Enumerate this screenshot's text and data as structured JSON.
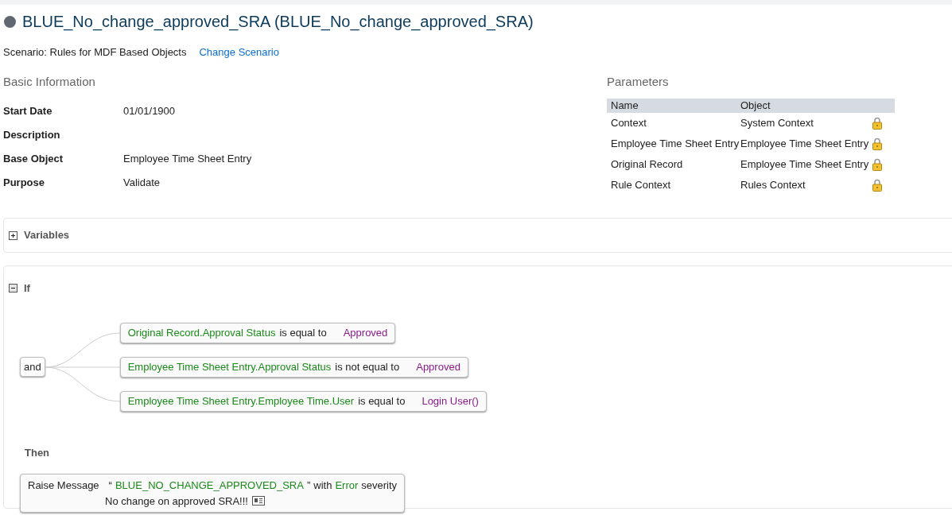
{
  "header": {
    "title": "BLUE_No_change_approved_SRA (BLUE_No_change_approved_SRA)",
    "scenario": "Scenario: Rules for MDF Based Objects",
    "change_link": "Change Scenario"
  },
  "basic_information": {
    "heading": "Basic Information",
    "fields": [
      {
        "label": "Start Date",
        "value": "01/01/1900"
      },
      {
        "label": "Description"
      },
      {
        "label": "Base Object",
        "value": "Employee Time Sheet Entry"
      },
      {
        "label": "Purpose",
        "value": "Validate"
      }
    ]
  },
  "parameters": {
    "heading": "Parameters",
    "columns": [
      "Name",
      "Object"
    ],
    "rows": [
      {
        "name": "Context",
        "object": "System Context",
        "locked": true
      },
      {
        "name": "Employee Time Sheet Entry",
        "object": "Employee Time Sheet Entry",
        "locked": true
      },
      {
        "name": "Original Record",
        "object": "Employee Time Sheet Entry",
        "locked": true
      },
      {
        "name": "Rule Context",
        "object": "Rules Context",
        "locked": true
      }
    ]
  },
  "variables": {
    "title": "Variables",
    "expanded": false
  },
  "if_section": {
    "title": "If",
    "expanded": true,
    "joiner": "and",
    "conditions": [
      {
        "field": "Original Record.Approval Status",
        "operator": "is equal to",
        "value": "Approved"
      },
      {
        "field": "Employee Time Sheet Entry.Approval Status",
        "operator": "is not equal to",
        "value": "Approved"
      },
      {
        "field": "Employee Time Sheet Entry.Employee Time.User",
        "operator": "is equal to",
        "value": "Login User()"
      }
    ],
    "then_title": "Then",
    "action": {
      "label": "Raise Message",
      "open_quote": "“",
      "message_key": "BLUE_NO_CHANGE_APPROVED_SRA",
      "close_quote": "”",
      "with": "with",
      "severity": "Error",
      "severity_word": "severity",
      "message": "No change on approved SRA!!!"
    }
  }
}
